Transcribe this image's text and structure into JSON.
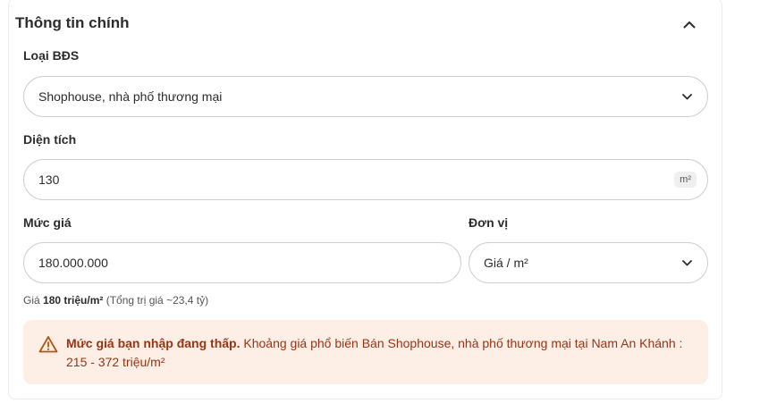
{
  "section": {
    "title": "Thông tin chính"
  },
  "property_type": {
    "label": "Loại BĐS",
    "value": "Shophouse, nhà phố thương mại"
  },
  "area": {
    "label": "Diện tích",
    "value": "130",
    "unit": "m²"
  },
  "price": {
    "label": "Mức giá",
    "value": "180.000.000"
  },
  "unit": {
    "label": "Đơn vị",
    "value": "Giá / m²"
  },
  "helper": {
    "prefix": "Giá ",
    "highlight": "180 triệu/m²",
    "suffix": " (Tổng trị giá ~23,4 tỷ)"
  },
  "warning": {
    "bold": "Mức giá bạn nhập đang thấp.",
    "text": " Khoảng giá phổ biến Bán Shophouse, nhà phố thương mại tại Nam An Khánh : 215 - 372 triệu/m²"
  },
  "colors": {
    "warning_bg": "#fdeee6",
    "warning_text": "#9a3412",
    "border": "#cfcfcf"
  }
}
